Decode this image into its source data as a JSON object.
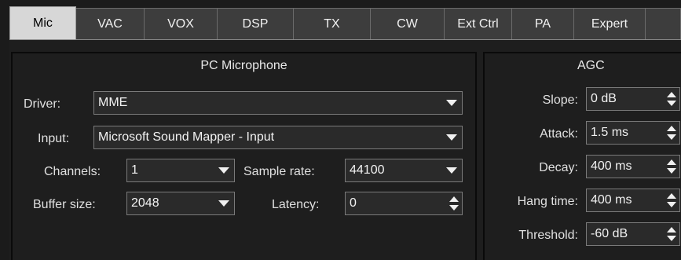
{
  "tabs": [
    {
      "label": "Mic",
      "active": true
    },
    {
      "label": "VAC",
      "active": false
    },
    {
      "label": "VOX",
      "active": false
    },
    {
      "label": "DSP",
      "active": false
    },
    {
      "label": "TX",
      "active": false
    },
    {
      "label": "CW",
      "active": false
    },
    {
      "label": "Ext Ctrl",
      "active": false
    },
    {
      "label": "PA",
      "active": false
    },
    {
      "label": "Expert",
      "active": false
    }
  ],
  "mic_group": {
    "title": "PC Microphone",
    "driver_label": "Driver:",
    "driver_value": "MME",
    "input_label": "Input:",
    "input_value": "Microsoft Sound Mapper - Input",
    "channels_label": "Channels:",
    "channels_value": "1",
    "sample_rate_label": "Sample rate:",
    "sample_rate_value": "44100",
    "buffer_size_label": "Buffer size:",
    "buffer_size_value": "2048",
    "latency_label": "Latency:",
    "latency_value": "0"
  },
  "agc_group": {
    "title": "AGC",
    "slope_label": "Slope:",
    "slope_value": "0 dB",
    "attack_label": "Attack:",
    "attack_value": "1.5 ms",
    "decay_label": "Decay:",
    "decay_value": "400 ms",
    "hang_time_label": "Hang time:",
    "hang_time_value": "400 ms",
    "threshold_label": "Threshold:",
    "threshold_value": "-60 dB"
  },
  "colors": {
    "background": "#1e1e1e",
    "tab_inactive": "#3d3d3d",
    "tab_active": "#d7d7d7",
    "field": "#2a2a2a",
    "border": "#7a7a7a",
    "text": "#e6e6e6"
  },
  "icons": {
    "dropdown": "chevron-down-icon",
    "spin_up": "chevron-up-icon",
    "spin_down": "chevron-down-icon"
  }
}
